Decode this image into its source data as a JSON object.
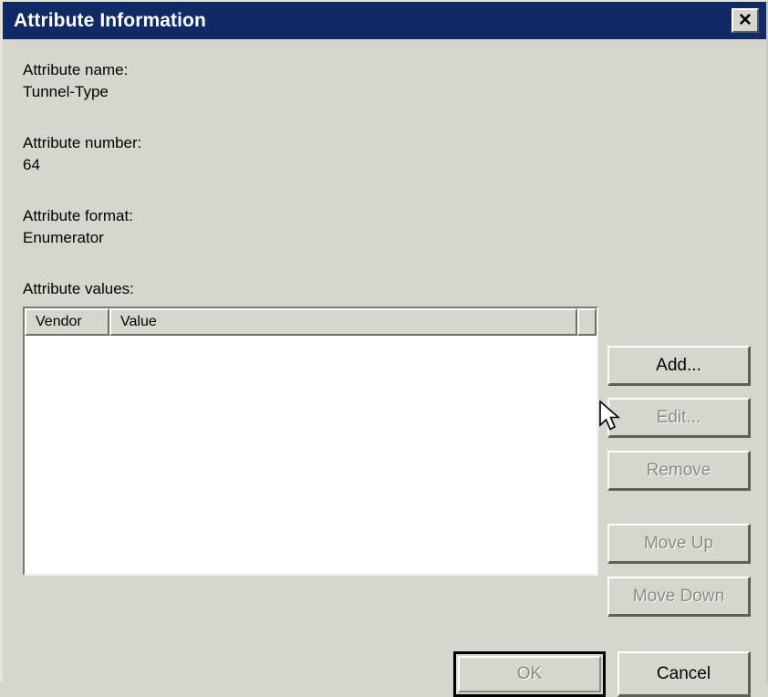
{
  "window": {
    "title": "Attribute Information",
    "close_label": "✕",
    "titlebar_color": "#102a66",
    "face_color": "#d6d6ce"
  },
  "fields": [
    {
      "label": "Attribute name:",
      "value": "Tunnel-Type"
    },
    {
      "label": "Attribute number:",
      "value": "64"
    },
    {
      "label": "Attribute format:",
      "value": "Enumerator"
    }
  ],
  "values_section": {
    "label": "Attribute values:",
    "columns": [
      "Vendor",
      "Value",
      ""
    ],
    "rows": []
  },
  "side_buttons": [
    {
      "label": "Add...",
      "enabled": true
    },
    {
      "label": "Edit...",
      "enabled": false
    },
    {
      "label": "Remove",
      "enabled": false
    },
    {
      "label": "Move Up",
      "enabled": false
    },
    {
      "label": "Move Down",
      "enabled": false
    }
  ],
  "footer": {
    "ok_label": "OK",
    "ok_enabled": false,
    "cancel_label": "Cancel",
    "cancel_enabled": true
  },
  "cursor": {
    "icon": "arrow-pointer-cursor"
  }
}
